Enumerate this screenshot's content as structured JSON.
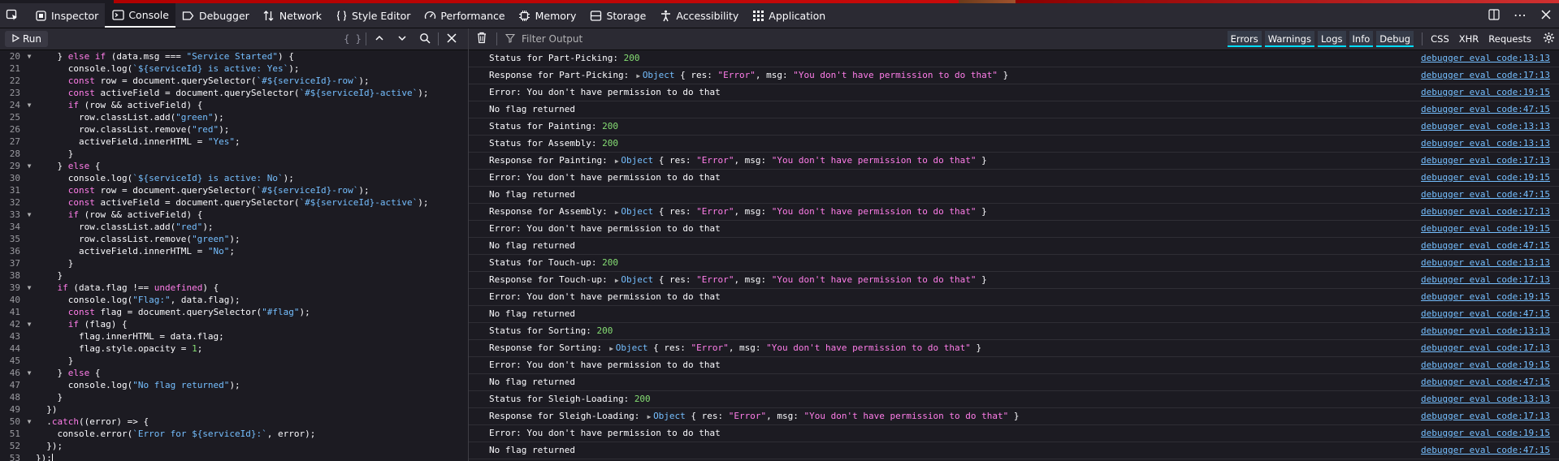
{
  "toolbar": {
    "tabs": [
      {
        "label": "Inspector",
        "icon": "inspector-icon"
      },
      {
        "label": "Console",
        "icon": "console-icon"
      },
      {
        "label": "Debugger",
        "icon": "debugger-icon"
      },
      {
        "label": "Network",
        "icon": "network-icon"
      },
      {
        "label": "Style Editor",
        "icon": "style-editor-icon"
      },
      {
        "label": "Performance",
        "icon": "performance-icon"
      },
      {
        "label": "Memory",
        "icon": "memory-icon"
      },
      {
        "label": "Storage",
        "icon": "storage-icon"
      },
      {
        "label": "Accessibility",
        "icon": "accessibility-icon"
      },
      {
        "label": "Application",
        "icon": "application-icon"
      }
    ],
    "selected_tab": "Console"
  },
  "editor": {
    "run_label": "Run",
    "lines": [
      {
        "n": "20",
        "fold": true,
        "html": "    } <kw>else if</kw> (data.msg === <s>\"Service Started\"</s>) {"
      },
      {
        "n": "21",
        "fold": false,
        "html": "      console.log(<s>`${serviceId} is active: Yes`</s>);"
      },
      {
        "n": "22",
        "fold": false,
        "html": "      <kw>const</kw> row = document.querySelector(<s>`#${serviceId}-row`</s>);"
      },
      {
        "n": "23",
        "fold": false,
        "html": "      <kw>const</kw> activeField = document.querySelector(<s>`#${serviceId}-active`</s>);"
      },
      {
        "n": "24",
        "fold": true,
        "html": "      <kw>if</kw> (row &amp;&amp; activeField) {"
      },
      {
        "n": "25",
        "fold": false,
        "html": "        row.classList.add(<s>\"green\"</s>);"
      },
      {
        "n": "26",
        "fold": false,
        "html": "        row.classList.remove(<s>\"red\"</s>);"
      },
      {
        "n": "27",
        "fold": false,
        "html": "        activeField.innerHTML = <s>\"Yes\"</s>;"
      },
      {
        "n": "28",
        "fold": false,
        "html": "      }"
      },
      {
        "n": "29",
        "fold": true,
        "html": "    } <kw>else</kw> {"
      },
      {
        "n": "30",
        "fold": false,
        "html": "      console.log(<s>`${serviceId} is active: No`</s>);"
      },
      {
        "n": "31",
        "fold": false,
        "html": "      <kw>const</kw> row = document.querySelector(<s>`#${serviceId}-row`</s>);"
      },
      {
        "n": "32",
        "fold": false,
        "html": "      <kw>const</kw> activeField = document.querySelector(<s>`#${serviceId}-active`</s>);"
      },
      {
        "n": "33",
        "fold": true,
        "html": "      <kw>if</kw> (row &amp;&amp; activeField) {"
      },
      {
        "n": "34",
        "fold": false,
        "html": "        row.classList.add(<s>\"red\"</s>);"
      },
      {
        "n": "35",
        "fold": false,
        "html": "        row.classList.remove(<s>\"green\"</s>);"
      },
      {
        "n": "36",
        "fold": false,
        "html": "        activeField.innerHTML = <s>\"No\"</s>;"
      },
      {
        "n": "37",
        "fold": false,
        "html": "      }"
      },
      {
        "n": "38",
        "fold": false,
        "html": "    }"
      },
      {
        "n": "39",
        "fold": true,
        "html": "    <kw>if</kw> (data.flag !== <kw>undefined</kw>) {"
      },
      {
        "n": "40",
        "fold": false,
        "html": "      console.log(<s>\"Flag:\"</s>, data.flag);"
      },
      {
        "n": "41",
        "fold": false,
        "html": "      <kw>const</kw> flag = document.querySelector(<s>\"#flag\"</s>);"
      },
      {
        "n": "42",
        "fold": true,
        "html": "      <kw>if</kw> (flag) {"
      },
      {
        "n": "43",
        "fold": false,
        "html": "        flag.innerHTML = data.flag;"
      },
      {
        "n": "44",
        "fold": false,
        "html": "        flag.style.opacity = <nm>1</nm>;"
      },
      {
        "n": "45",
        "fold": false,
        "html": "      }"
      },
      {
        "n": "46",
        "fold": true,
        "html": "    } <kw>else</kw> {"
      },
      {
        "n": "47",
        "fold": false,
        "html": "      console.log(<s>\"No flag returned\"</s>);"
      },
      {
        "n": "48",
        "fold": false,
        "html": "    }"
      },
      {
        "n": "49",
        "fold": false,
        "html": "  })"
      },
      {
        "n": "50",
        "fold": true,
        "html": "  .<kw>catch</kw>((error) =&gt; {"
      },
      {
        "n": "51",
        "fold": false,
        "html": "    console.error(<s>`Error for ${serviceId}:`</s>, error);"
      },
      {
        "n": "52",
        "fold": false,
        "html": "  });"
      },
      {
        "n": "53",
        "fold": false,
        "html": "});<caret>"
      }
    ]
  },
  "console": {
    "filter_placeholder": "Filter Output",
    "levels": [
      "Errors",
      "Warnings",
      "Logs",
      "Info",
      "Debug"
    ],
    "extra_filters": [
      "CSS",
      "XHR",
      "Requests"
    ],
    "messages": [
      {
        "kind": "status",
        "label": "Status for Part-Picking: ",
        "code": "200",
        "src": "debugger eval code:13:13"
      },
      {
        "kind": "object",
        "label": "Response for Part-Picking: ",
        "obj": {
          "res": "Error",
          "msg": "You don't have permission to do that"
        },
        "src": "debugger eval code:17:13"
      },
      {
        "kind": "text",
        "label": "Error: You don't have permission to do that",
        "src": "debugger eval code:19:15"
      },
      {
        "kind": "text",
        "label": "No flag returned",
        "src": "debugger eval code:47:15"
      },
      {
        "kind": "status",
        "label": "Status for Painting: ",
        "code": "200",
        "src": "debugger eval code:13:13"
      },
      {
        "kind": "status",
        "label": "Status for Assembly: ",
        "code": "200",
        "src": "debugger eval code:13:13"
      },
      {
        "kind": "object",
        "label": "Response for Painting: ",
        "obj": {
          "res": "Error",
          "msg": "You don't have permission to do that"
        },
        "src": "debugger eval code:17:13"
      },
      {
        "kind": "text",
        "label": "Error: You don't have permission to do that",
        "src": "debugger eval code:19:15"
      },
      {
        "kind": "text",
        "label": "No flag returned",
        "src": "debugger eval code:47:15"
      },
      {
        "kind": "object",
        "label": "Response for Assembly: ",
        "obj": {
          "res": "Error",
          "msg": "You don't have permission to do that"
        },
        "src": "debugger eval code:17:13"
      },
      {
        "kind": "text",
        "label": "Error: You don't have permission to do that",
        "src": "debugger eval code:19:15"
      },
      {
        "kind": "text",
        "label": "No flag returned",
        "src": "debugger eval code:47:15"
      },
      {
        "kind": "status",
        "label": "Status for Touch-up: ",
        "code": "200",
        "src": "debugger eval code:13:13"
      },
      {
        "kind": "object",
        "label": "Response for Touch-up: ",
        "obj": {
          "res": "Error",
          "msg": "You don't have permission to do that"
        },
        "src": "debugger eval code:17:13"
      },
      {
        "kind": "text",
        "label": "Error: You don't have permission to do that",
        "src": "debugger eval code:19:15"
      },
      {
        "kind": "text",
        "label": "No flag returned",
        "src": "debugger eval code:47:15"
      },
      {
        "kind": "status",
        "label": "Status for Sorting: ",
        "code": "200",
        "src": "debugger eval code:13:13"
      },
      {
        "kind": "object",
        "label": "Response for Sorting: ",
        "obj": {
          "res": "Error",
          "msg": "You don't have permission to do that"
        },
        "src": "debugger eval code:17:13"
      },
      {
        "kind": "text",
        "label": "Error: You don't have permission to do that",
        "src": "debugger eval code:19:15"
      },
      {
        "kind": "text",
        "label": "No flag returned",
        "src": "debugger eval code:47:15"
      },
      {
        "kind": "status",
        "label": "Status for Sleigh-Loading: ",
        "code": "200",
        "src": "debugger eval code:13:13"
      },
      {
        "kind": "object",
        "label": "Response for Sleigh-Loading: ",
        "obj": {
          "res": "Error",
          "msg": "You don't have permission to do that"
        },
        "src": "debugger eval code:17:13"
      },
      {
        "kind": "text",
        "label": "Error: You don't have permission to do that",
        "src": "debugger eval code:19:15"
      },
      {
        "kind": "text",
        "label": "No flag returned",
        "src": "debugger eval code:47:15"
      }
    ]
  },
  "colors": {
    "keyword": "#ff7de9",
    "string": "#75bfff",
    "number": "#86de74",
    "link": "#75bfff",
    "accent": "#00ddff"
  }
}
